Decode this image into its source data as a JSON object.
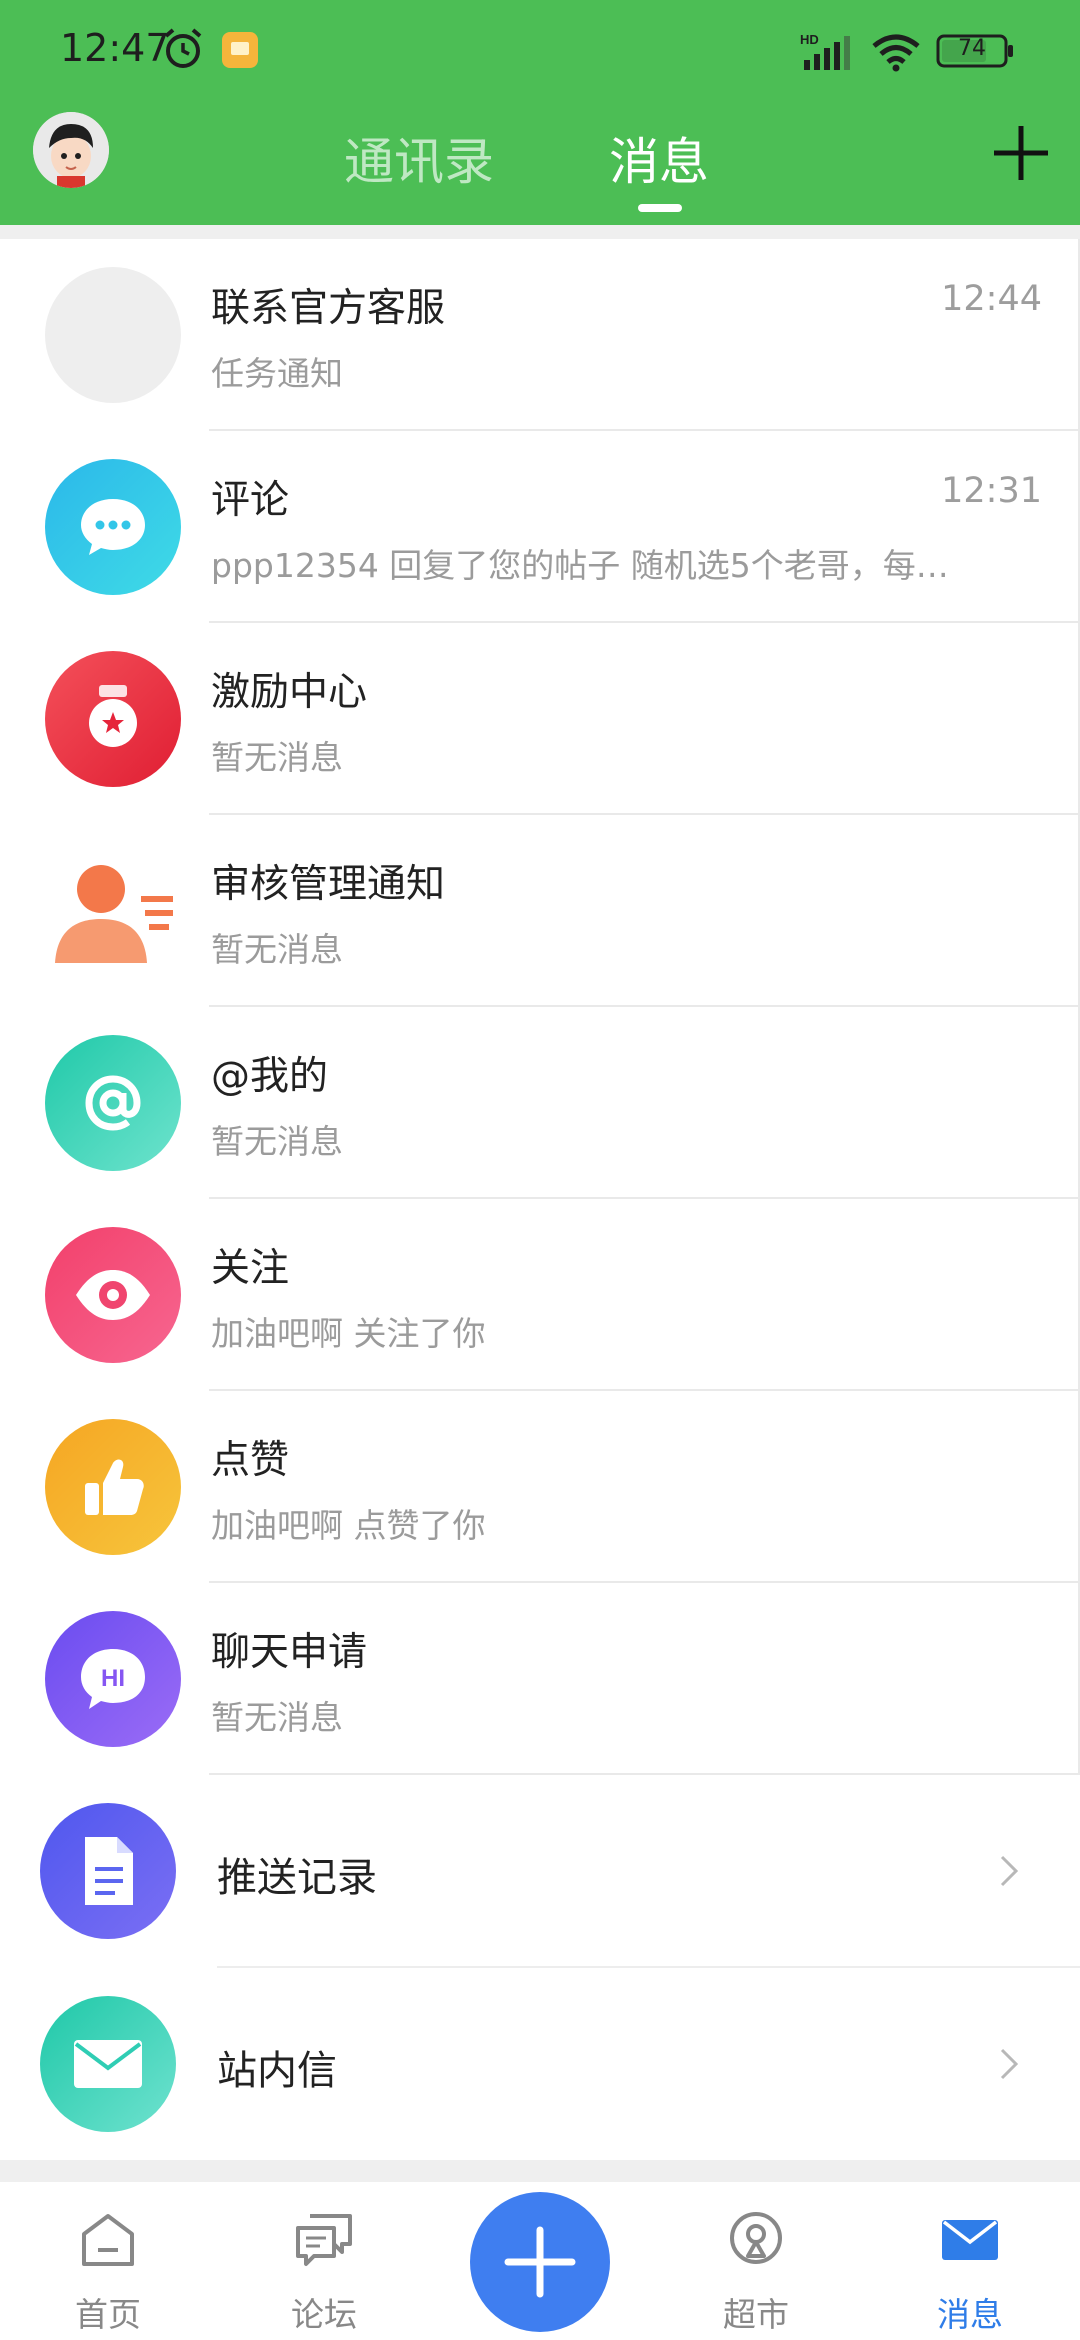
{
  "status_bar": {
    "time": "12:47",
    "network": "HD",
    "battery": "74"
  },
  "header": {
    "tabs": [
      {
        "label": "通讯录",
        "active": false
      },
      {
        "label": "消息",
        "active": true
      }
    ]
  },
  "messages": [
    {
      "title": "联系官方客服",
      "subtitle": "任务通知",
      "time": "12:44",
      "icon": "placeholder-avatar",
      "color": "#eeeeee"
    },
    {
      "title": "评论",
      "subtitle": "ppp12354 回复了您的帖子 随机选5个老哥，每…",
      "time": "12:31",
      "icon": "chat-bubble-icon",
      "color": "#33c6e8"
    },
    {
      "title": "激励中心",
      "subtitle": "暂无消息",
      "time": "",
      "icon": "medal-icon",
      "color": "#ee2b3d"
    },
    {
      "title": "审核管理通知",
      "subtitle": "暂无消息",
      "time": "",
      "icon": "person-list-icon",
      "color": "#f37a4b"
    },
    {
      "title": "@我的",
      "subtitle": "暂无消息",
      "time": "",
      "icon": "at-icon",
      "color": "#2fd0b2"
    },
    {
      "title": "关注",
      "subtitle": "加油吧啊 关注了你",
      "time": "",
      "icon": "eye-icon",
      "color": "#f0456f"
    },
    {
      "title": "点赞",
      "subtitle": "加油吧啊 点赞了你",
      "time": "",
      "icon": "thumbs-up-icon",
      "color": "#f5ad22"
    },
    {
      "title": "聊天申请",
      "subtitle": "暂无消息",
      "time": "",
      "icon": "hi-bubble-icon",
      "color": "#8656f2"
    }
  ],
  "links": [
    {
      "title": "推送记录",
      "icon": "document-icon",
      "color": "#5b66f0"
    },
    {
      "title": "站内信",
      "icon": "envelope-icon",
      "color": "#27cdb4"
    }
  ],
  "bottom_nav": [
    {
      "label": "首页",
      "icon": "home-icon",
      "active": false
    },
    {
      "label": "论坛",
      "icon": "forum-icon",
      "active": false
    },
    {
      "label": "",
      "icon": "plus-icon",
      "active": false
    },
    {
      "label": "超市",
      "icon": "market-icon",
      "active": false
    },
    {
      "label": "消息",
      "icon": "mail-icon",
      "active": true
    }
  ],
  "colors": {
    "header_green": "#4cbe55",
    "active_blue": "#2f7de8",
    "fab_blue": "#3f7ef0"
  }
}
